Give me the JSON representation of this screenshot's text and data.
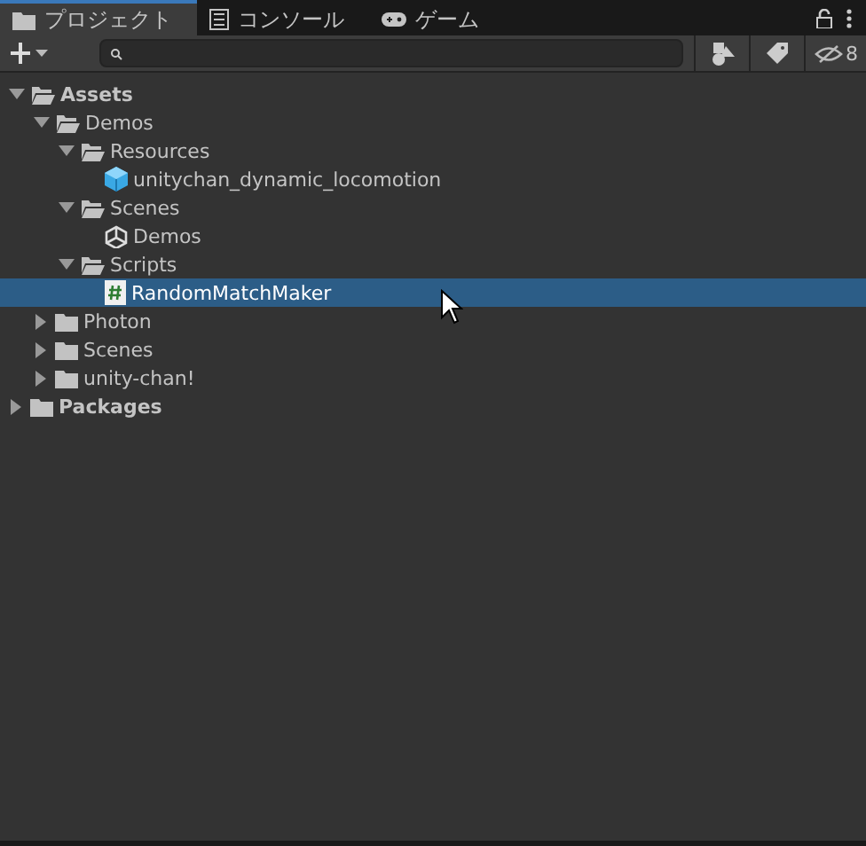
{
  "tabs": [
    {
      "label": "プロジェクト",
      "kind": "folder",
      "selected": true
    },
    {
      "label": "コンソール",
      "kind": "console",
      "selected": false
    },
    {
      "label": "ゲーム",
      "kind": "gamepad",
      "selected": false
    }
  ],
  "toolbar": {
    "hidden_count": "8"
  },
  "tree": [
    {
      "label": "Assets",
      "kind": "folder",
      "expanded": true,
      "selected": false,
      "children": [
        {
          "label": "Demos",
          "kind": "folder",
          "expanded": true,
          "selected": false,
          "children": [
            {
              "label": "Resources",
              "kind": "folder",
              "expanded": true,
              "selected": false,
              "children": [
                {
                  "label": "unitychan_dynamic_locomotion",
                  "kind": "prefab",
                  "selected": false
                }
              ]
            },
            {
              "label": "Scenes",
              "kind": "folder",
              "expanded": true,
              "selected": false,
              "children": [
                {
                  "label": "Demos",
                  "kind": "scene",
                  "selected": false
                }
              ]
            },
            {
              "label": "Scripts",
              "kind": "folder",
              "expanded": true,
              "selected": false,
              "children": [
                {
                  "label": "RandomMatchMaker",
                  "kind": "script",
                  "selected": true
                }
              ]
            }
          ]
        },
        {
          "label": "Photon",
          "kind": "folder",
          "expanded": false,
          "selected": false
        },
        {
          "label": "Scenes",
          "kind": "folder",
          "expanded": false,
          "selected": false
        },
        {
          "label": "unity-chan!",
          "kind": "folder",
          "expanded": false,
          "selected": false
        }
      ]
    },
    {
      "label": "Packages",
      "kind": "folder",
      "expanded": false,
      "selected": false
    }
  ]
}
